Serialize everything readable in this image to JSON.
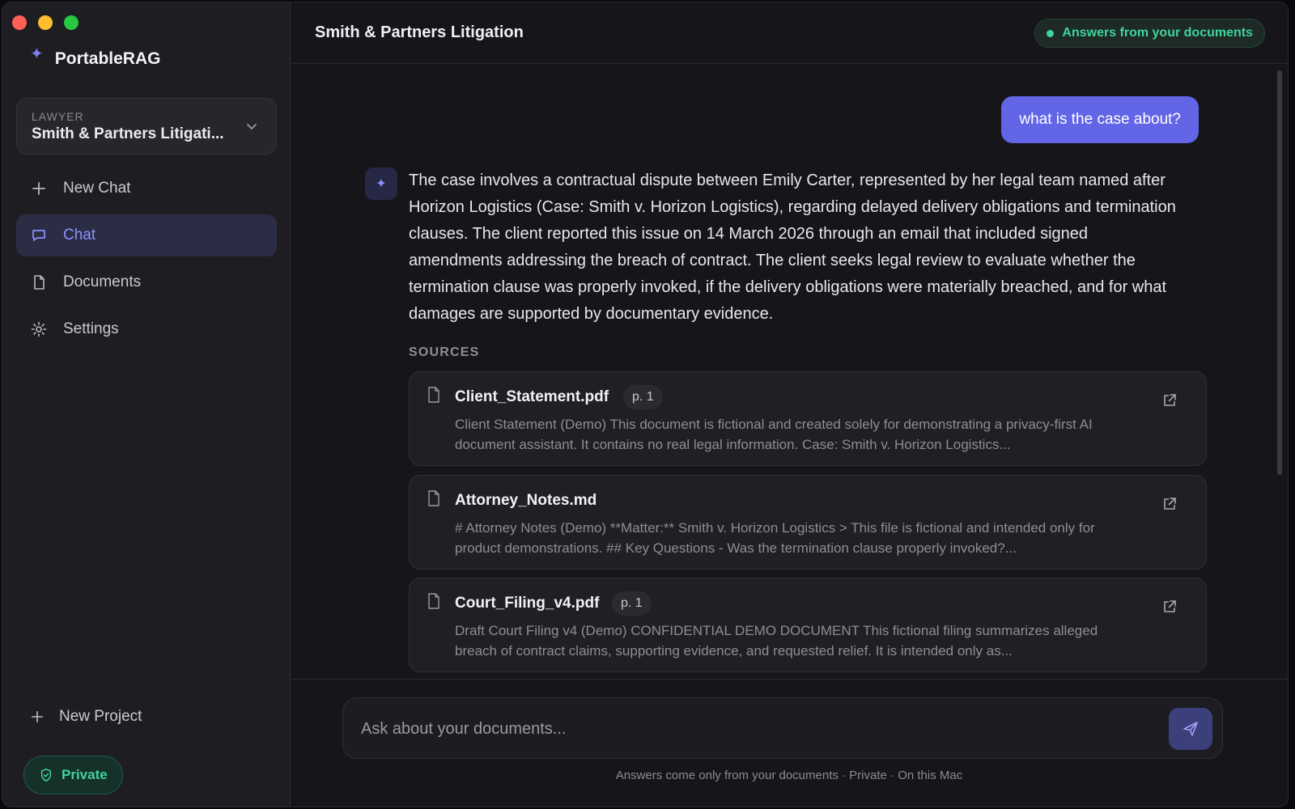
{
  "window": {
    "controls": [
      "close",
      "minimize",
      "maximize"
    ]
  },
  "sidebar": {
    "brand": "PortableRAG",
    "project_select": {
      "caption": "LAWYER",
      "value": "Smith & Partners Litigati..."
    },
    "nav": [
      {
        "label": "New Chat",
        "icon": "plus-icon"
      },
      {
        "label": "Chat",
        "icon": "chat-bubble-icon",
        "active": true
      },
      {
        "label": "Documents",
        "icon": "document-icon"
      },
      {
        "label": "Settings",
        "icon": "gear-icon"
      }
    ],
    "new_project": "New Project",
    "private_badge": "Private"
  },
  "header": {
    "title": "Smith & Partners Litigation",
    "status": "Answers from your documents"
  },
  "conversation": {
    "user_message": "what is the case about?",
    "answer": "The case involves a contractual dispute between Emily Carter, represented by her legal team named after Horizon Logistics (Case: Smith v. Horizon Logistics), regarding delayed delivery obligations and termination clauses. The client reported this issue on 14 March 2026 through an email that included signed amendments addressing the breach of contract. The client seeks legal review to evaluate whether the termination clause was properly invoked, if the delivery obligations were materially breached, and for what damages are supported by documentary evidence.",
    "sources_label": "SOURCES",
    "sources": [
      {
        "file": "Client_Statement.pdf",
        "page": "p. 1",
        "snippet": "Client Statement (Demo) This document is fictional and created solely for demonstrating a privacy-first AI document assistant. It contains no real legal information. Case: Smith v. Horizon Logistics..."
      },
      {
        "file": "Attorney_Notes.md",
        "page": "",
        "snippet": "# Attorney Notes (Demo) **Matter:** Smith v. Horizon Logistics > This file is fictional and intended only for product demonstrations. ## Key Questions - Was the termination clause properly invoked?..."
      },
      {
        "file": "Court_Filing_v4.pdf",
        "page": "p. 1",
        "snippet": "Draft Court Filing v4 (Demo) CONFIDENTIAL DEMO DOCUMENT This fictional filing summarizes alleged breach of contract claims, supporting evidence, and requested relief. It is intended only as..."
      }
    ]
  },
  "composer": {
    "placeholder": "Ask about your documents...",
    "footnote": "Answers come only from your documents · Private · On this Mac"
  },
  "colors": {
    "accent": "#6265e6",
    "success": "#3fd49a",
    "background": "#16161a"
  }
}
